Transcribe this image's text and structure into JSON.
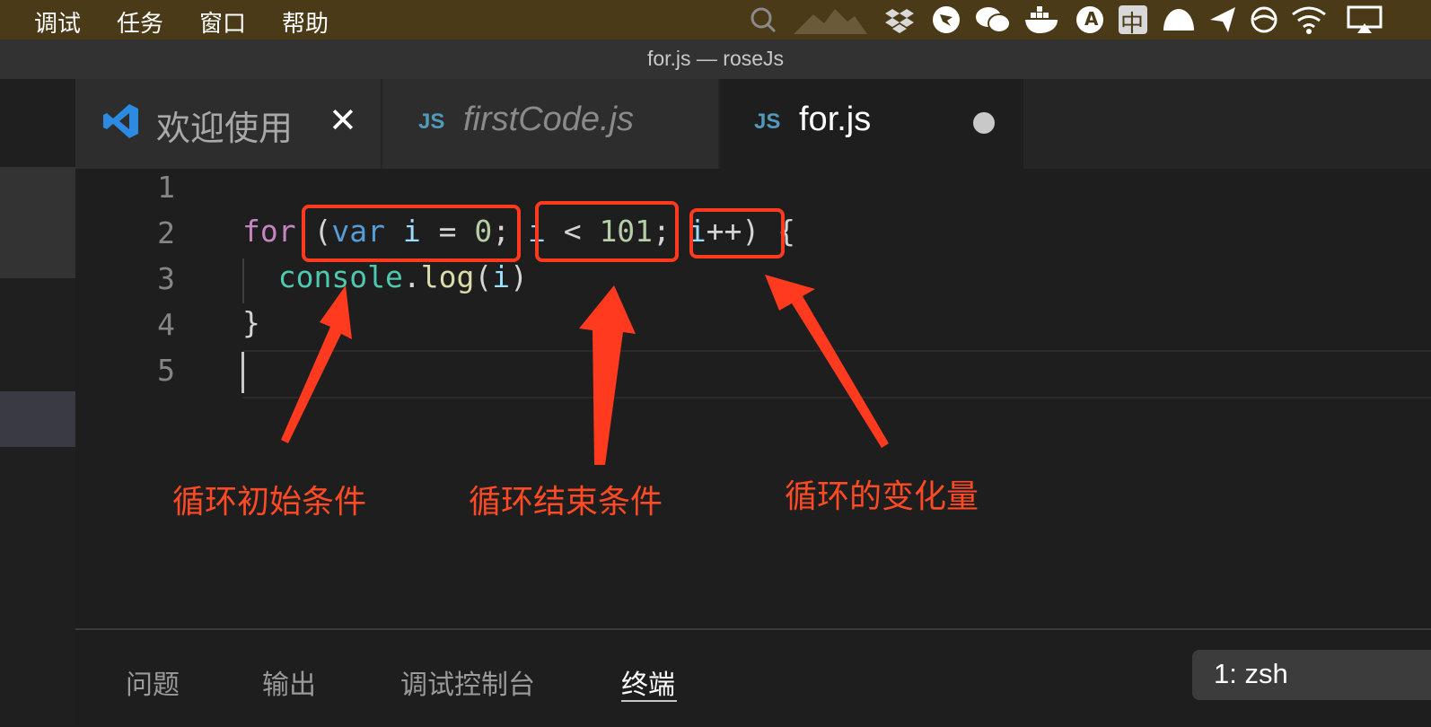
{
  "menubar": {
    "items": [
      "调试",
      "任务",
      "窗口",
      "帮助"
    ],
    "tray": {
      "ime_letter": "A",
      "ime_lang": "中"
    }
  },
  "window": {
    "title": "for.js — roseJs"
  },
  "tabs": [
    {
      "label": "欢迎使用",
      "icon": "vscode-icon",
      "close": "✕"
    },
    {
      "label": "firstCode.js",
      "badge": "JS"
    },
    {
      "label": "for.js",
      "badge": "JS",
      "dirty": true
    }
  ],
  "editor": {
    "line_numbers": [
      "1",
      "2",
      "3",
      "4",
      "5"
    ],
    "code": {
      "for_kw": "for",
      "open_paren": "(",
      "var_kw": "var",
      "i1": "i",
      "eq": " = ",
      "zero": "0",
      "semi1": ";",
      "i2": "i",
      "lt": " < ",
      "limit": "101",
      "semi2": ";",
      "i3": "i",
      "inc": "++",
      "close_paren": ")",
      "brace_open": "{",
      "console": "console",
      "dot": ".",
      "log": "log",
      "log_open": "(",
      "log_arg": "i",
      "log_close": ")",
      "brace_close": "}"
    }
  },
  "annotations": {
    "init": "循环初始条件",
    "end": "循环结束条件",
    "change": "循环的变化量"
  },
  "panel": {
    "tabs": [
      "问题",
      "输出",
      "调试控制台",
      "终端"
    ],
    "terminal": "1: zsh"
  },
  "colors": {
    "annotation": "#ff3a1f",
    "menubar": "#4a3a18",
    "accent_js": "#519aba"
  }
}
